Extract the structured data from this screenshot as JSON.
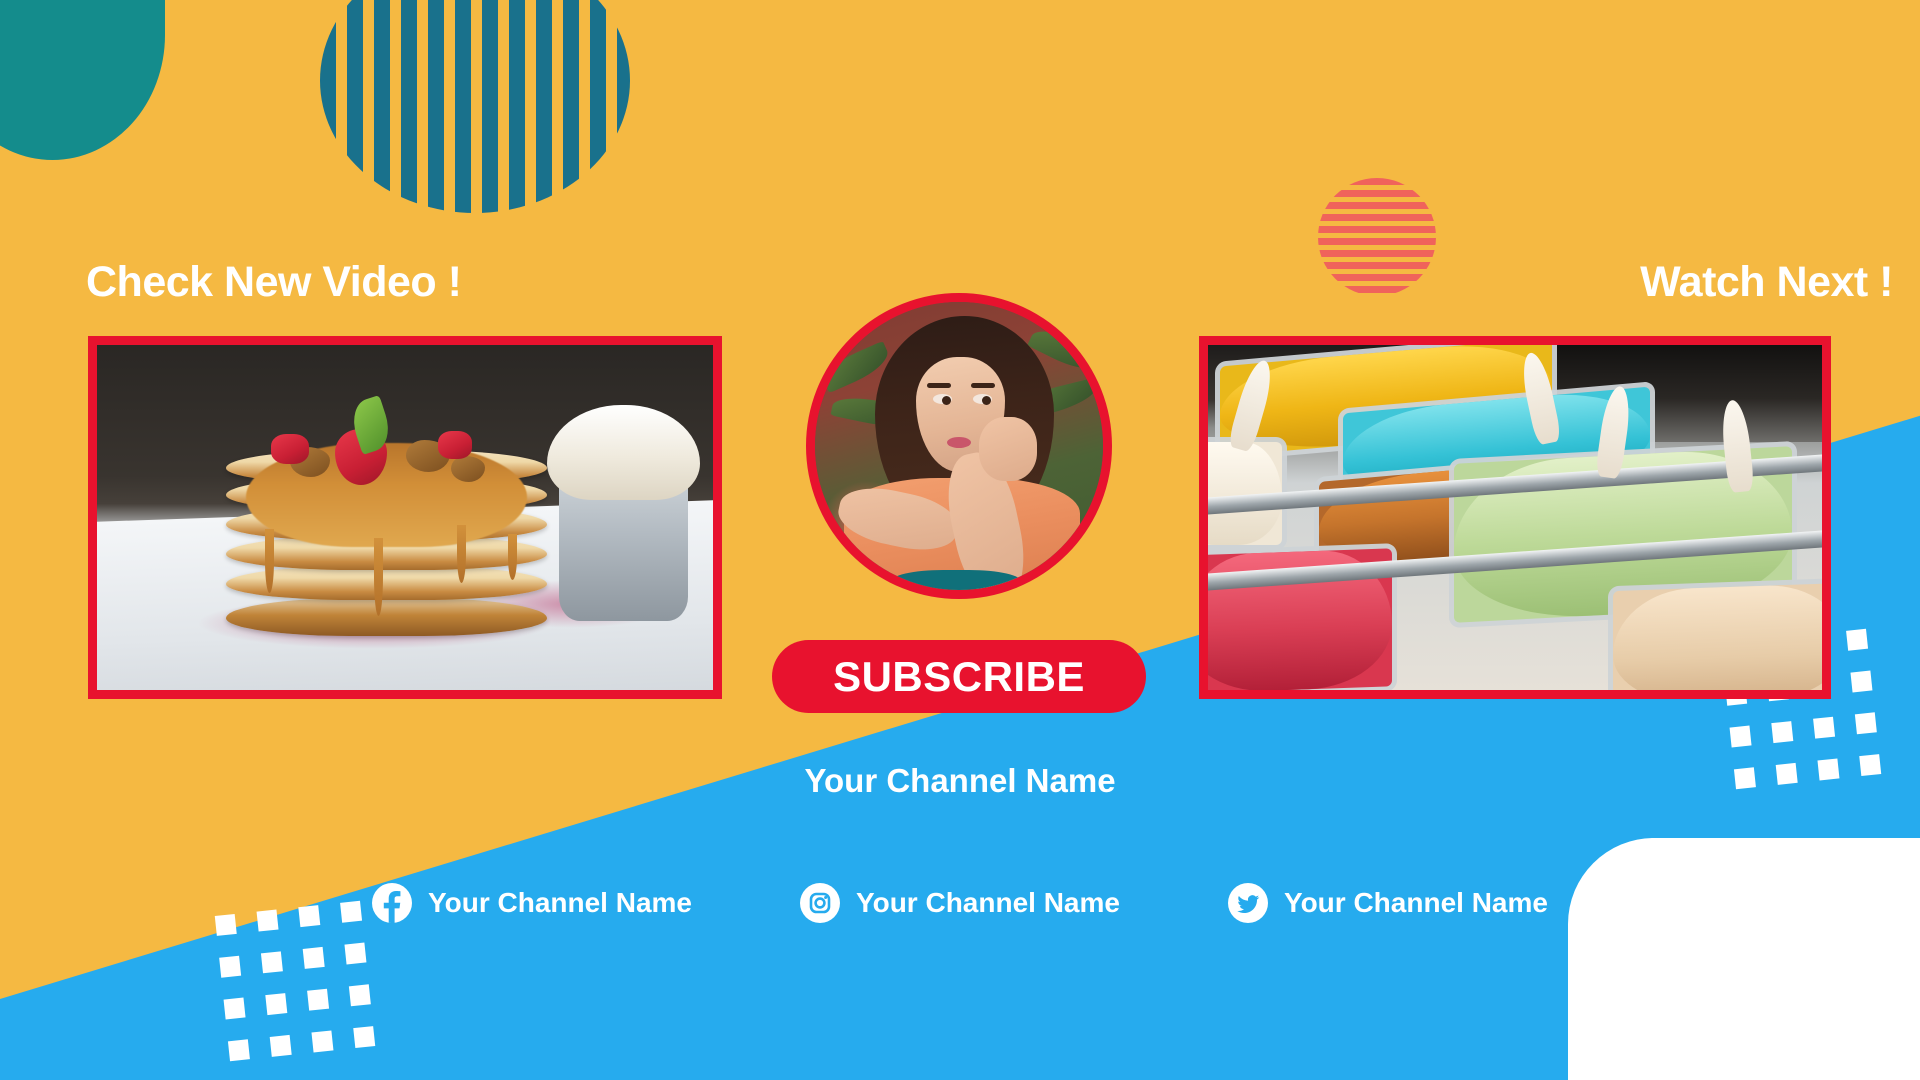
{
  "palette": {
    "yellow": "#F5B942",
    "blue": "#26ABEE",
    "teal": "#148C8C",
    "teal_stripe": "#19718C",
    "coral": "#F0635B",
    "red": "#E8122E",
    "white": "#FFFFFF"
  },
  "headings": {
    "left": "Check New Video !",
    "right": "Watch Next !"
  },
  "thumbnails": {
    "left": {
      "name": "pancake-stack-thumbnail",
      "description": "Stack of pancakes with caramel sauce, strawberries, mint and walnuts on a white plate beside a metal cup of cream"
    },
    "right": {
      "name": "gelato-display-thumbnail",
      "description": "Ice cream display case with mango, blue, caramel, pistachio and strawberry gelato in metal pans"
    }
  },
  "avatar": {
    "name": "channel-avatar",
    "description": "Portrait of a woman in an orange top with hand at her neck, plants behind her"
  },
  "subscribe": {
    "label": "SUBSCRIBE"
  },
  "channel": {
    "name": "Your Channel Name"
  },
  "socials": [
    {
      "icon": "facebook-icon",
      "label": "Your Channel Name"
    },
    {
      "icon": "instagram-icon",
      "label": "Your Channel Name"
    },
    {
      "icon": "twitter-icon",
      "label": "Your Channel Name"
    }
  ],
  "decorations": {
    "teal_quarter_circle": "teal-quarter-circle",
    "striped_circle_teal": "vertical-striped-circle",
    "striped_circle_coral": "horizontal-striped-circle",
    "dot_grid_left": "dot-grid",
    "dot_grid_right": "dot-grid",
    "white_rounded_corner": "white-rounded-corner"
  }
}
